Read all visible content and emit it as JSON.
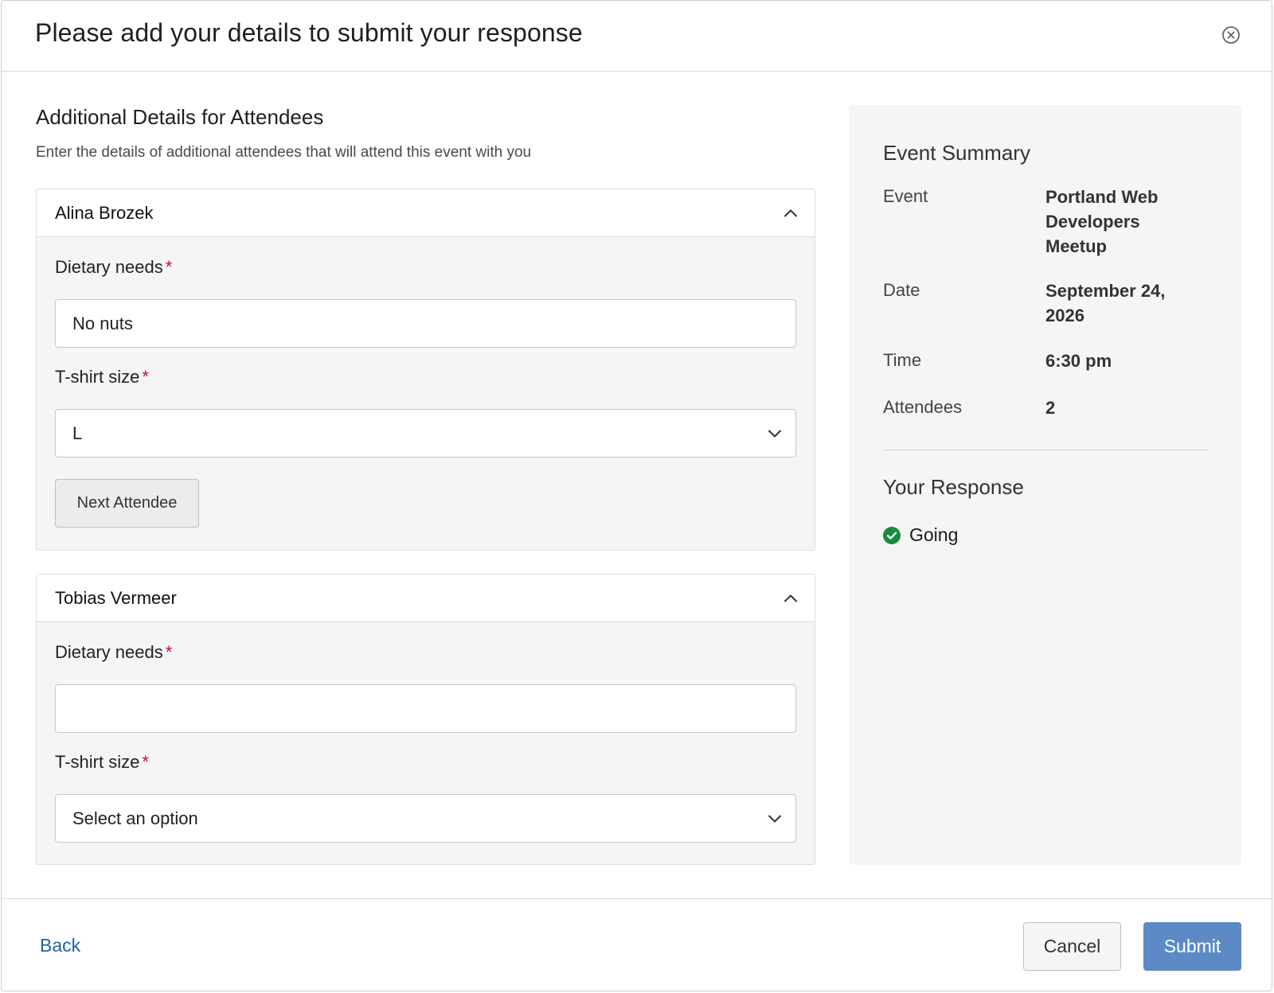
{
  "header": {
    "title": "Please add your details to submit your response",
    "close_icon": "close-circle-icon"
  },
  "main": {
    "section_title": "Additional Details for Attendees",
    "section_description": "Enter the details of additional attendees that will attend this event with you",
    "attendees": [
      {
        "name": "Alina Brozek",
        "dietary_label": "Dietary needs",
        "dietary_value": "No nuts",
        "tshirt_label": "T-shirt size",
        "tshirt_value": "L",
        "next_button_label": "Next Attendee"
      },
      {
        "name": "Tobias Vermeer",
        "dietary_label": "Dietary needs",
        "dietary_value": "",
        "tshirt_label": "T-shirt size",
        "tshirt_value": "Select an option"
      }
    ],
    "required_marker": "*"
  },
  "summary": {
    "title": "Event Summary",
    "rows": [
      {
        "label": "Event",
        "value": "Portland Web Developers Meetup"
      },
      {
        "label": "Date",
        "value": "September 24, 2026"
      },
      {
        "label": "Time",
        "value": "6:30 pm"
      },
      {
        "label": "Attendees",
        "value": "2"
      }
    ],
    "response_title": "Your Response",
    "response_value": "Going",
    "response_icon": "check-circle-icon"
  },
  "footer": {
    "back_label": "Back",
    "cancel_label": "Cancel",
    "submit_label": "Submit"
  },
  "colors": {
    "accent": "#5b8ac6",
    "link": "#1f63a8",
    "required": "#c8102e",
    "success": "#1a8a3a"
  }
}
